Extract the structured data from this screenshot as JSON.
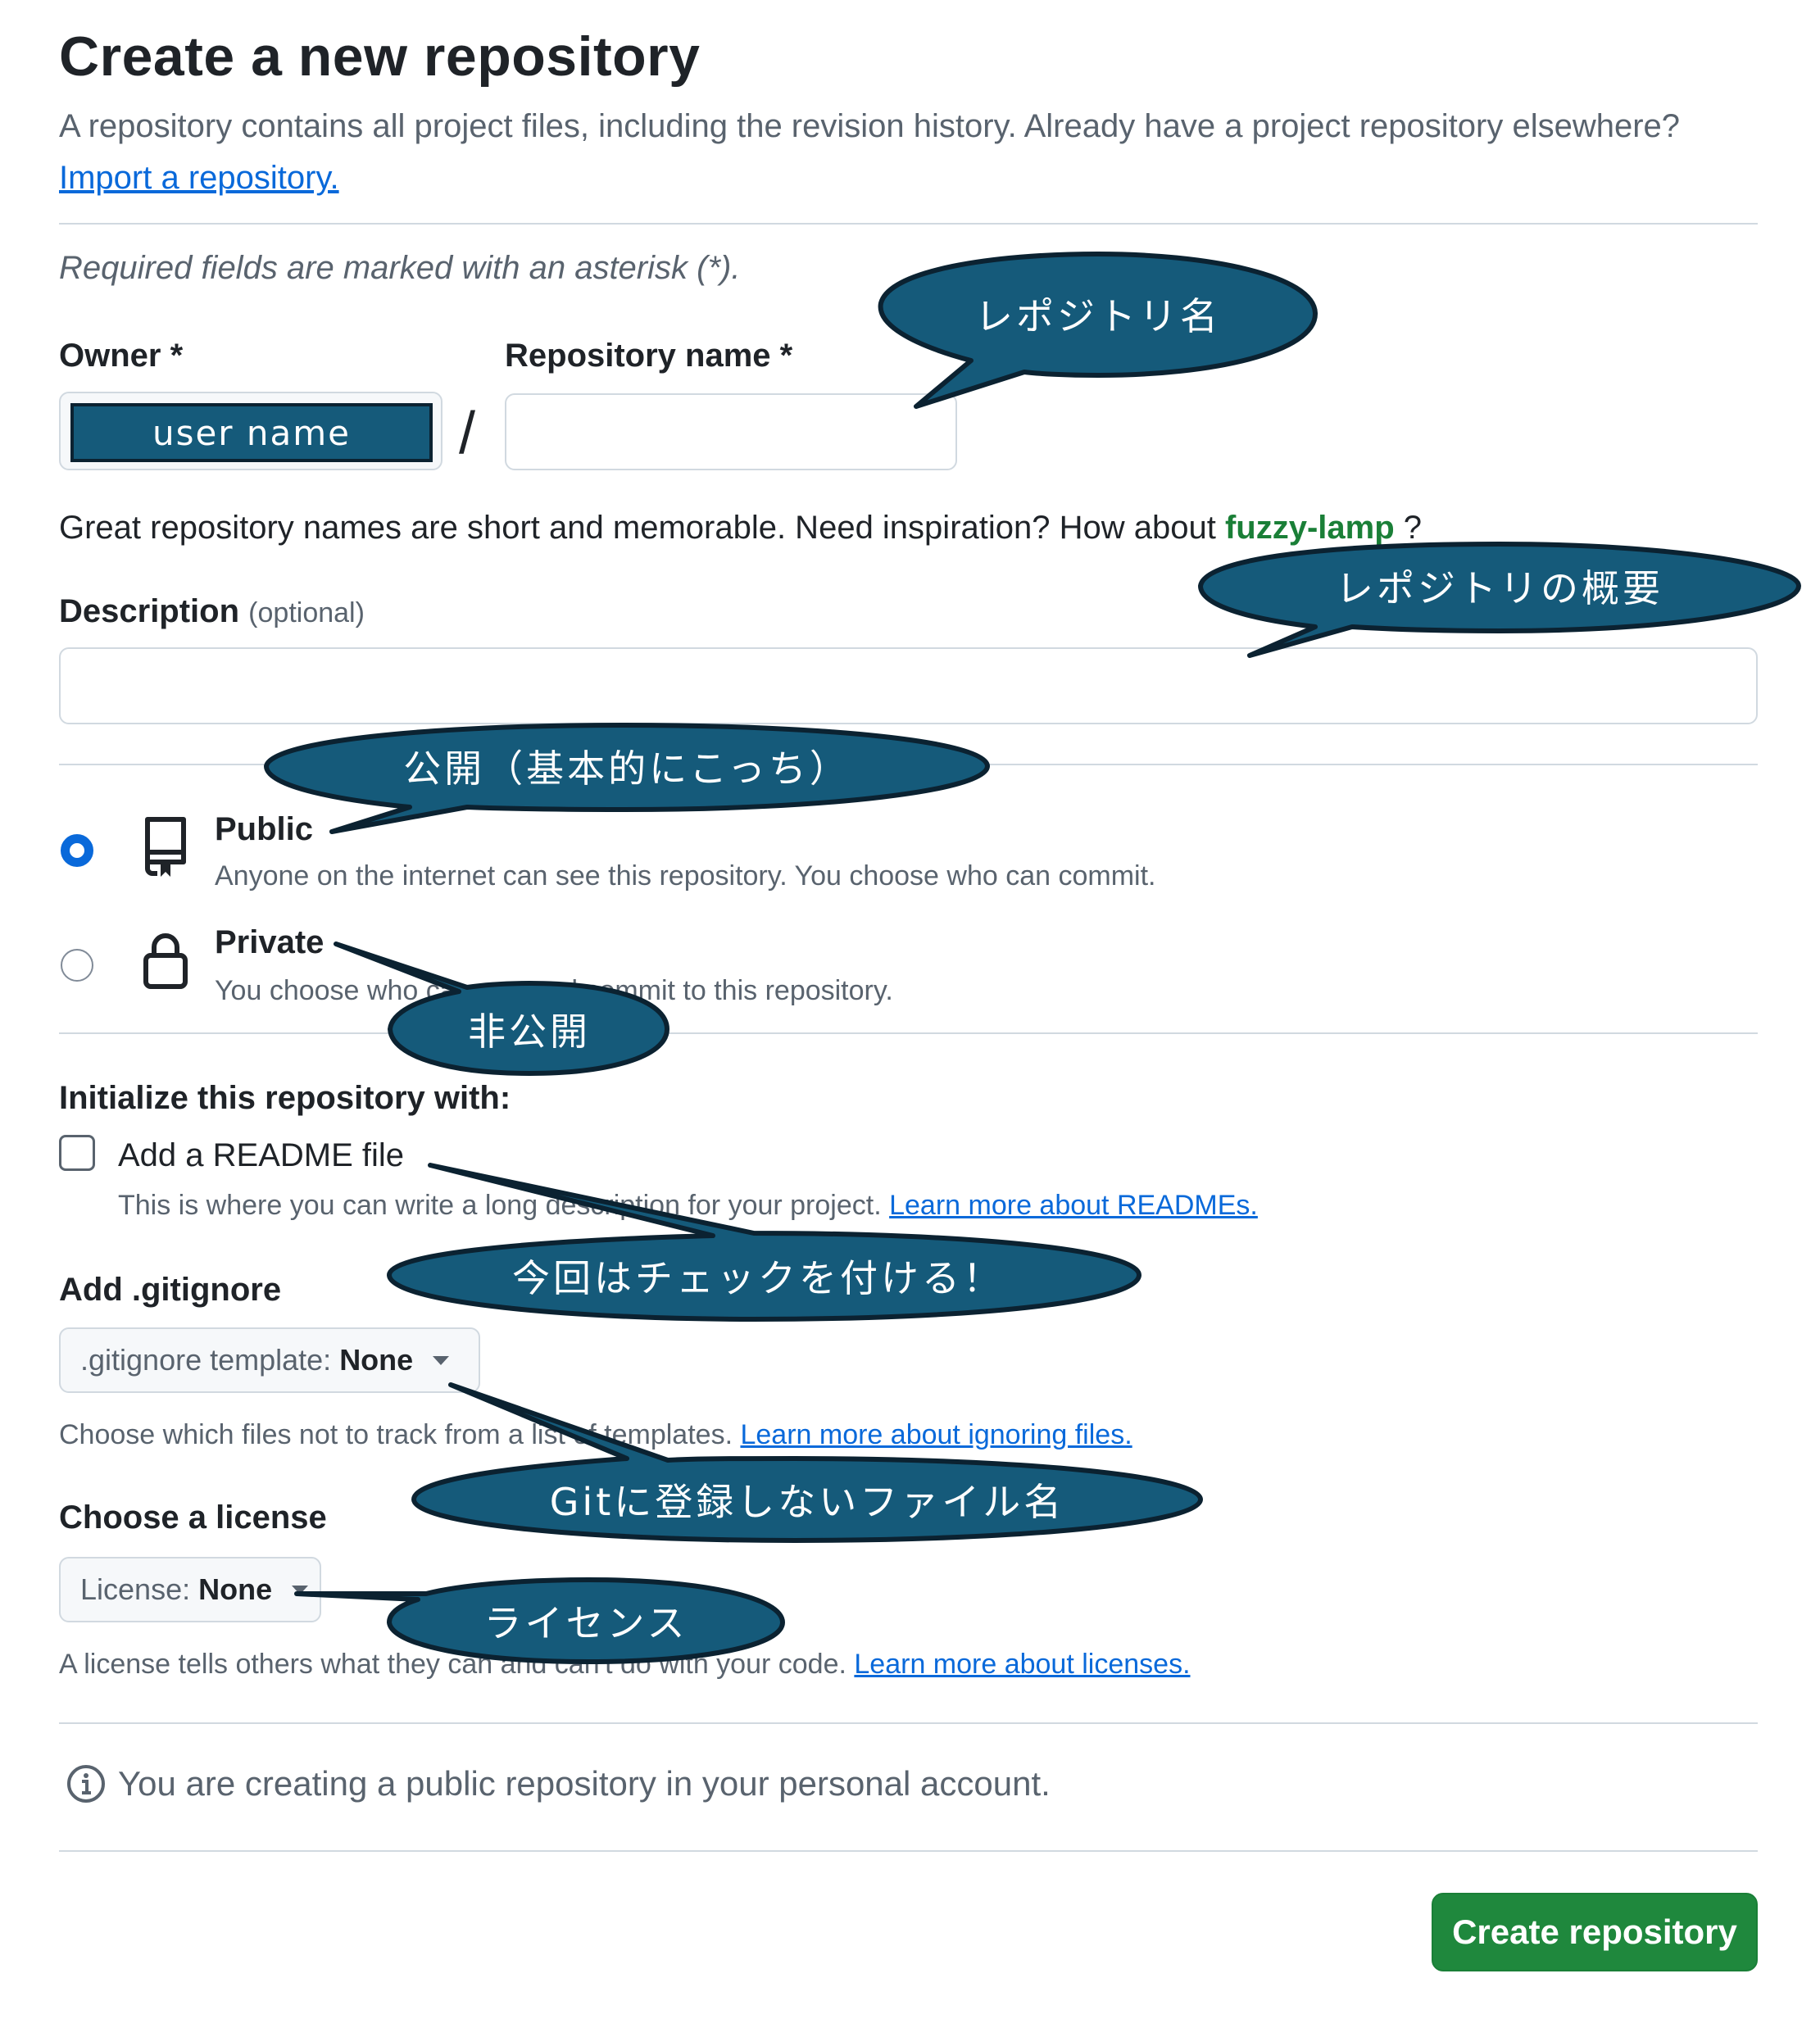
{
  "header": {
    "title": "Create a new repository",
    "subtitle": "A repository contains all project files, including the revision history. Already have a project repository elsewhere?",
    "import_link": "Import a repository."
  },
  "required_note": "Required fields are marked with an asterisk (*).",
  "owner": {
    "label": "Owner *",
    "value": "user name"
  },
  "slash": "/",
  "repo_name": {
    "label": "Repository name *",
    "value": ""
  },
  "name_hint": {
    "text": "Great repository names are short and memorable. Need inspiration? How about",
    "suggestion": "fuzzy-lamp",
    "suffix": " ?"
  },
  "description": {
    "label": "Description",
    "optional": "(optional)",
    "value": ""
  },
  "visibility": {
    "public_title": "Public",
    "public_desc": "Anyone on the internet can see this repository. You choose who can commit.",
    "private_title": "Private",
    "private_desc": "You choose who can see and commit to this repository.",
    "selected": "public"
  },
  "init": {
    "heading": "Initialize this repository with:",
    "readme_label": "Add a README file",
    "readme_desc": "This is where you can write a long description for your project.",
    "readme_link": "Learn more about READMEs.",
    "readme_checked": false
  },
  "gitignore": {
    "heading": "Add .gitignore",
    "select_prefix": ".gitignore template:",
    "select_value": "None",
    "desc": "Choose which files not to track from a list of templates.",
    "link": "Learn more about ignoring files."
  },
  "license": {
    "heading": "Choose a license",
    "select_prefix": "License:",
    "select_value": "None",
    "desc": "A license tells others what they can and can't do with your code.",
    "link": "Learn more about licenses."
  },
  "info": {
    "text": "You are creating a public repository in your personal account."
  },
  "create_button": "Create repository",
  "annotations": {
    "repo_name": "レポジトリ名",
    "description": "レポジトリの概要",
    "public": "公開（基本的にこっち）",
    "private": "非公開",
    "readme": "今回はチェックを付ける！",
    "gitignore": "Gitに登録しないファイル名",
    "license": "ライセンス"
  },
  "colors": {
    "callout_fill": "#155a7a",
    "callout_stroke": "#0b2231",
    "primary_button": "#1f883d",
    "link": "#0969da",
    "suggestion": "#1a7f37"
  }
}
